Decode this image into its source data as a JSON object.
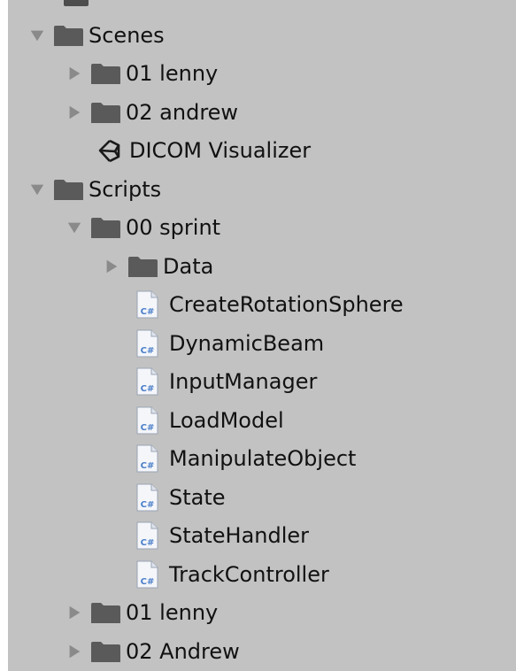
{
  "tree": {
    "items": [
      {
        "label": "Scenes",
        "type": "folder",
        "expanded": true,
        "depth": 0
      },
      {
        "label": "01 lenny",
        "type": "folder",
        "expanded": false,
        "depth": 1
      },
      {
        "label": "02 andrew",
        "type": "folder",
        "expanded": false,
        "depth": 1
      },
      {
        "label": "DICOM Visualizer",
        "type": "unity-scene",
        "depth": 1
      },
      {
        "label": "Scripts",
        "type": "folder",
        "expanded": true,
        "depth": 0
      },
      {
        "label": "00 sprint",
        "type": "folder",
        "expanded": true,
        "depth": 1
      },
      {
        "label": "Data",
        "type": "folder",
        "expanded": false,
        "depth": 2
      },
      {
        "label": "CreateRotationSphere",
        "type": "csharp-script",
        "depth": 2
      },
      {
        "label": "DynamicBeam",
        "type": "csharp-script",
        "depth": 2
      },
      {
        "label": "InputManager",
        "type": "csharp-script",
        "depth": 2
      },
      {
        "label": "LoadModel",
        "type": "csharp-script",
        "depth": 2
      },
      {
        "label": "ManipulateObject",
        "type": "csharp-script",
        "depth": 2
      },
      {
        "label": "State",
        "type": "csharp-script",
        "depth": 2
      },
      {
        "label": "StateHandler",
        "type": "csharp-script",
        "depth": 2
      },
      {
        "label": "TrackController",
        "type": "csharp-script",
        "depth": 2
      },
      {
        "label": "01 lenny",
        "type": "folder",
        "expanded": false,
        "depth": 1
      },
      {
        "label": "02 Andrew",
        "type": "folder",
        "expanded": false,
        "depth": 1
      }
    ]
  },
  "icons": {
    "folder": "folder-icon",
    "expanded": "expand-arrow-down-icon",
    "collapsed": "expand-arrow-right-icon",
    "unity-scene": "unity-logo-icon",
    "csharp-script": "csharp-script-icon",
    "csharp_glyph": "C#"
  },
  "colors": {
    "panel_background": "#c2c2c2",
    "folder": "#5a5a5a",
    "arrow": "#8a8a8a",
    "text": "#111111",
    "script_icon_accent": "#4a7ec9"
  }
}
